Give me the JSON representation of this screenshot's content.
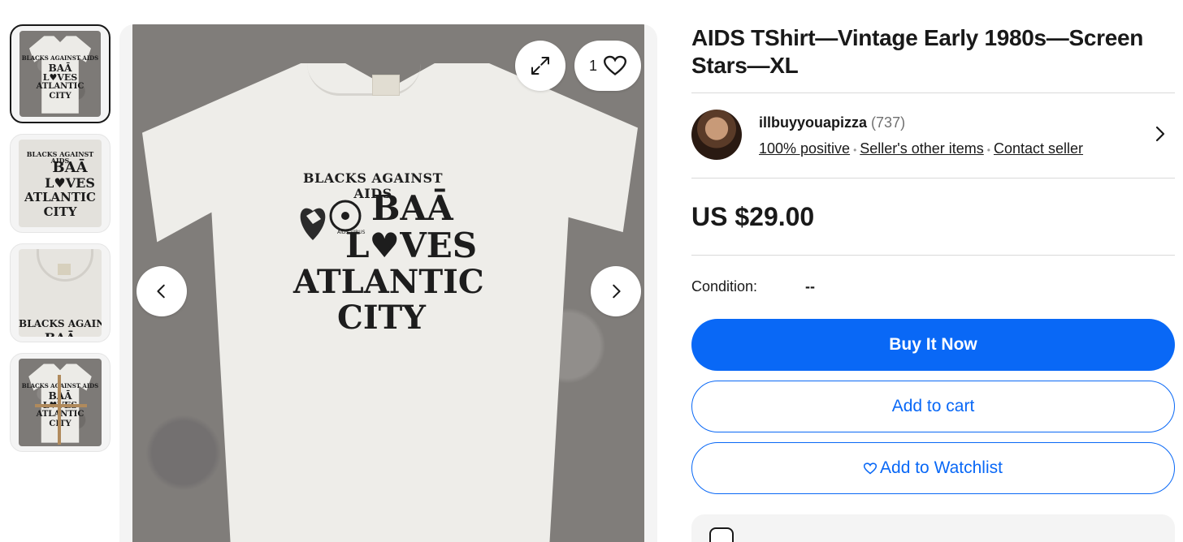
{
  "listing": {
    "title": "AIDS TShirt—Vintage Early 1980s—Screen Stars—XL",
    "price": "US $29.00",
    "condition_label": "Condition:",
    "condition_value": "--"
  },
  "seller": {
    "name": "illbuyyouapizza",
    "feedback_count": "(737)",
    "positive": "100% positive",
    "other_items": "Seller's other items",
    "contact": "Contact seller"
  },
  "actions": {
    "buy_now": "Buy It Now",
    "add_to_cart": "Add to cart",
    "add_to_watchlist": "Add to Watchlist"
  },
  "gallery": {
    "watch_count": "1",
    "selected_index": 0,
    "thumbnails": [
      "front",
      "print-closeup",
      "collar-closeup",
      "measured"
    ]
  },
  "shirt_print": {
    "top_line": "BLACKS AGAINST AIDS",
    "line1": "BAĀ",
    "line2_a": "L",
    "line2_b": "VES",
    "line3": "ATLANTIC",
    "line4": "CITY",
    "badge": "AIDS VIRUS"
  },
  "colors": {
    "accent": "#0968f6",
    "text": "#191919",
    "muted": "#707070"
  },
  "icons": [
    "expand-icon",
    "heart-icon",
    "chevron-left-icon",
    "chevron-right-icon"
  ]
}
